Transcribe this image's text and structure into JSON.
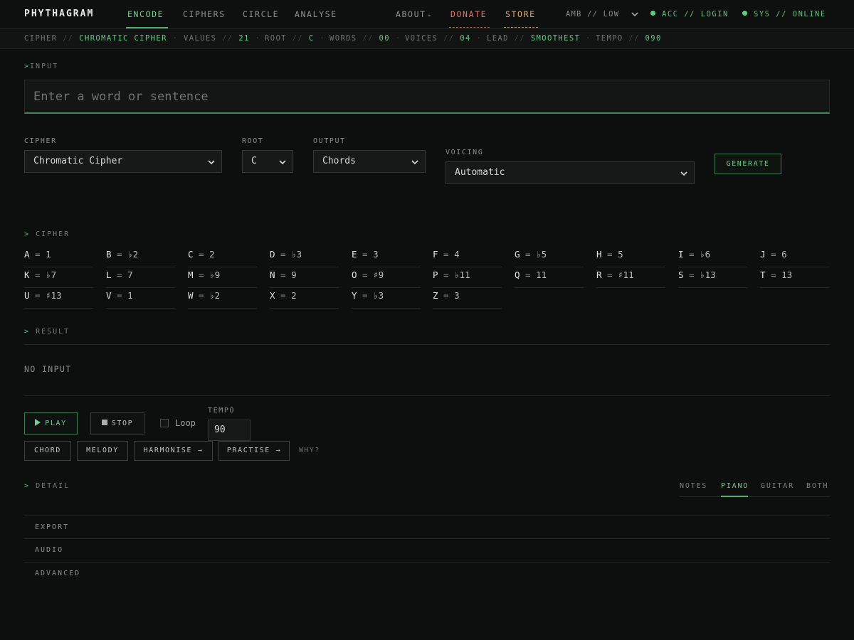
{
  "brand": "PHYTHAGRAM",
  "nav": {
    "links": [
      {
        "label": "ENCODE"
      },
      {
        "label": "CIPHERS"
      },
      {
        "label": "CIRCLE"
      },
      {
        "label": "ANALYSE"
      }
    ],
    "about": "ABOUT",
    "about_mark": "+",
    "donate": "DONATE",
    "store": "STORE",
    "amb": "AMB // LOW",
    "acc": "ACC // LOGIN",
    "sys": "SYS // ONLINE",
    "colors": {
      "active": "#6fcf8c",
      "donate": "#e0726a",
      "store": "#e2a86a"
    }
  },
  "status": [
    {
      "key": "CIPHER",
      "value": "CHROMATIC CIPHER"
    },
    {
      "key": "VALUES",
      "value": "21"
    },
    {
      "key": "ROOT",
      "value": "C"
    },
    {
      "key": "WORDS",
      "value": "00"
    },
    {
      "key": "VOICES",
      "value": "04"
    },
    {
      "key": "LEAD",
      "value": "SMOOTHEST"
    },
    {
      "key": "TEMPO",
      "value": "090"
    }
  ],
  "status_sep": "//",
  "status_dot": "·",
  "input": {
    "section": "INPUT",
    "placeholder": "Enter a word or sentence"
  },
  "section_marker": ">",
  "controls": {
    "cipher_label": "CIPHER",
    "cipher_value": "Chromatic Cipher",
    "root_label": "ROOT",
    "root_value": "C",
    "output_label": "OUTPUT",
    "output_value": "Chords",
    "voicing_label": "VOICING",
    "voicing_value": "Automatic",
    "generate": "GENERATE"
  },
  "cipher": {
    "section": "CIPHER",
    "entries": [
      {
        "letter": "A",
        "value": "1"
      },
      {
        "letter": "B",
        "value": "♭2"
      },
      {
        "letter": "C",
        "value": "2"
      },
      {
        "letter": "D",
        "value": "♭3"
      },
      {
        "letter": "E",
        "value": "3"
      },
      {
        "letter": "F",
        "value": "4"
      },
      {
        "letter": "G",
        "value": "♭5"
      },
      {
        "letter": "H",
        "value": "5"
      },
      {
        "letter": "I",
        "value": "♭6"
      },
      {
        "letter": "J",
        "value": "6"
      },
      {
        "letter": "K",
        "value": "♭7"
      },
      {
        "letter": "L",
        "value": "7"
      },
      {
        "letter": "M",
        "value": "♭9"
      },
      {
        "letter": "N",
        "value": "9"
      },
      {
        "letter": "O",
        "value": "♯9"
      },
      {
        "letter": "P",
        "value": "♭11"
      },
      {
        "letter": "Q",
        "value": "11"
      },
      {
        "letter": "R",
        "value": "♯11"
      },
      {
        "letter": "S",
        "value": "♭13"
      },
      {
        "letter": "T",
        "value": "13"
      },
      {
        "letter": "U",
        "value": "♯13"
      },
      {
        "letter": "V",
        "value": "1"
      },
      {
        "letter": "W",
        "value": "♭2"
      },
      {
        "letter": "X",
        "value": "2"
      },
      {
        "letter": "Y",
        "value": "♭3"
      },
      {
        "letter": "Z",
        "value": "3"
      }
    ]
  },
  "result": {
    "section": "RESULT",
    "empty": "NO INPUT"
  },
  "playback": {
    "play": "PLAY",
    "stop": "STOP",
    "loop": "Loop",
    "tempo_label": "TEMPO",
    "tempo_value": "90",
    "chord": "CHORD",
    "melody": "MELODY",
    "harmonise": "HARMONISE →",
    "practise": "PRACTISE →",
    "why": "WHY?"
  },
  "detail": {
    "section": "DETAIL",
    "tabs": [
      "NOTES",
      "PIANO",
      "GUITAR",
      "BOTH"
    ],
    "active_tab": "PIANO"
  },
  "accordion": [
    "EXPORT",
    "AUDIO",
    "ADVANCED"
  ]
}
